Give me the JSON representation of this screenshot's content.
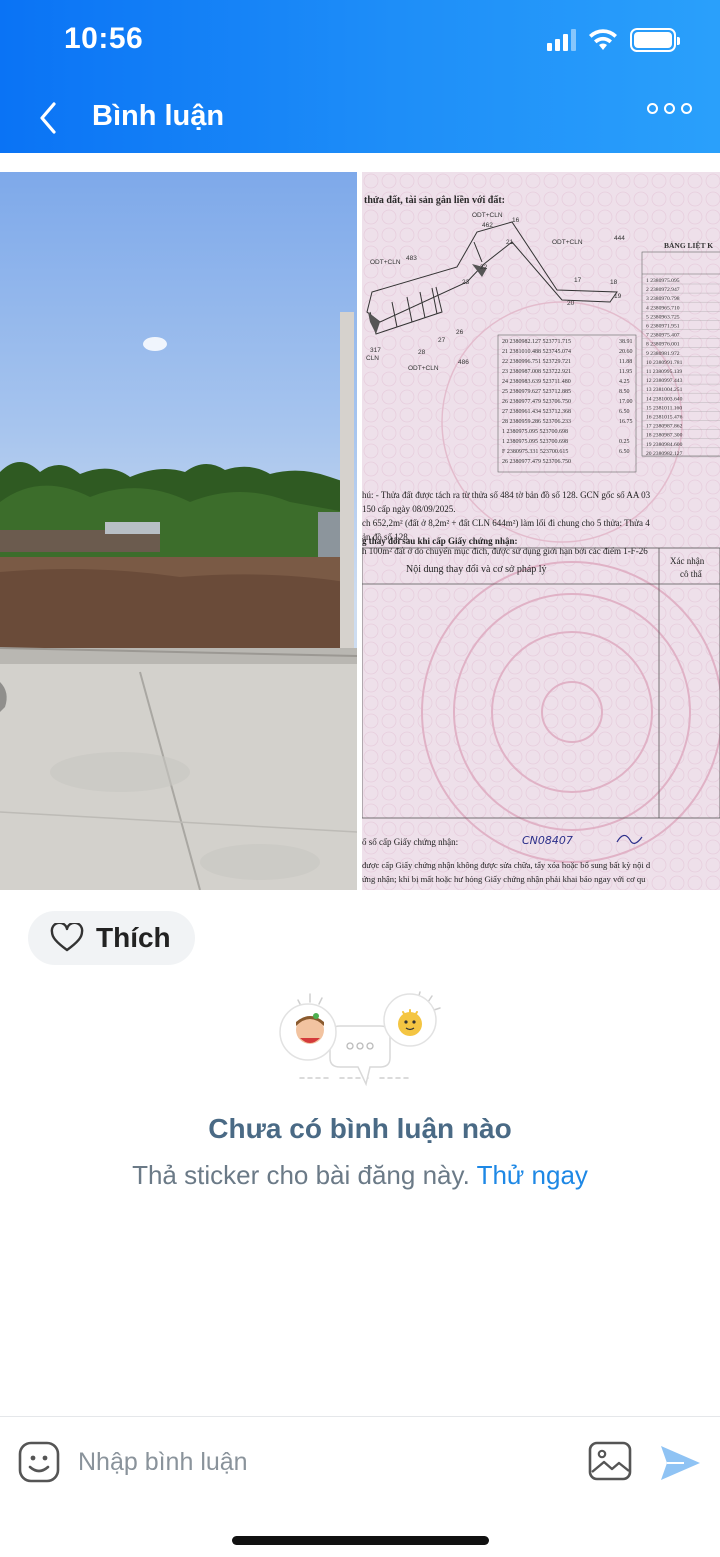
{
  "status_bar": {
    "time": "10:56"
  },
  "header": {
    "title": "Bình luận"
  },
  "post": {
    "document_heading": "thửa đất, tài sản gắn liền với đất:",
    "document_lines": [
      "hú: - Thửa đất được tách ra từ thửa số 484 tờ bản đồ số 128. GCN gốc số AA 03",
      "150 cấp ngày 08/09/2025.",
      "ch 652,2m² (đất ở 8,2m² + đất CLN 644m²) làm lối đi chung cho 5 thửa: Thửa 4",
      "ản đồ số 128.",
      "h 100m² đất ở do chuyển mục đích, được sử dụng giới hạn bởi các điểm 1-F-26",
      "g thay đổi sau khi cấp Giấy chứng nhận:"
    ],
    "table_header_left": "Nội dung thay đổi và cơ sở pháp lý",
    "table_header_right": "Xác nhận",
    "table_header_right2": "cô thẩ",
    "registry_line": "ố số cấp Giấy chứng nhận:",
    "registry_number": "CN08407",
    "footer_lines": [
      "được cấp Giấy chứng nhận không được sửa chữa, tẩy xóa hoặc bổ sung bất kỳ nội d",
      "ứng nhận; khi bị mất hoặc hư hỏng Giấy chứng nhận phải khai báo ngay với cơ qu"
    ],
    "coords_title": "BẢNG LIỆT K",
    "coords_rows": [
      "1  2380975.095",
      "2  2380972.947",
      "3  2380970.798",
      "4  2380965.710",
      "5  2380963.725",
      "6  2380971.951",
      "7  2380975.407",
      "8  2380976.001",
      "9  2380981.972",
      "10 2380991.781",
      "11 2380995.139",
      "12 2380997.443",
      "13 2381004.251",
      "14 2381003.640",
      "15 2381011.160",
      "16 2381015.476",
      "17 2380987.862",
      "18 2380987.300",
      "19 2380984.600",
      "20 2380982.127"
    ],
    "like_label": "Thích"
  },
  "empty_state": {
    "title": "Chưa có bình luận nào",
    "subtitle": "Thả sticker cho bài đăng này.",
    "cta": "Thử ngay"
  },
  "composer": {
    "placeholder": "Nhập bình luận"
  },
  "colors": {
    "header_start": "#0a73f5",
    "header_end": "#2aa0fb",
    "link": "#1e88e5",
    "send": "#8fc3f4"
  }
}
